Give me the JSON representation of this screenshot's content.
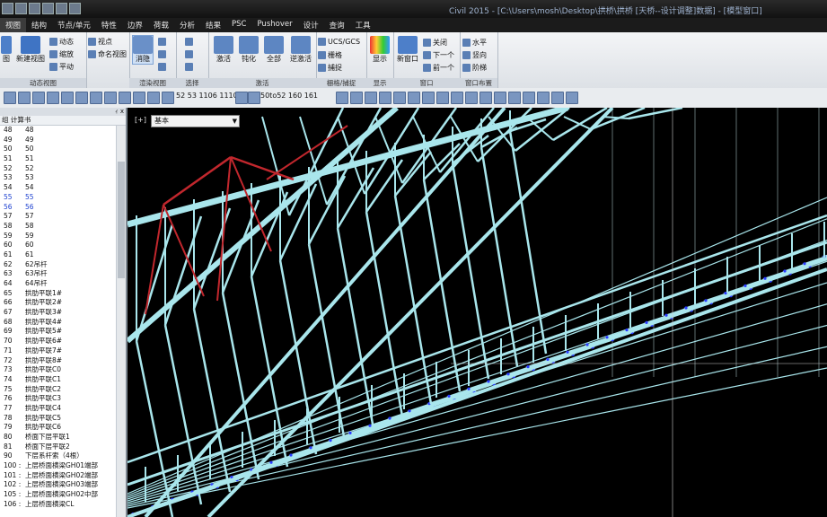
{
  "window": {
    "title": "Civil 2015 - [C:\\Users\\mosh\\Desktop\\拱桥\\拱桥 [天桥--设计调整]数据] - [模型窗口]"
  },
  "menu": [
    "视图",
    "结构",
    "节点/单元",
    "特性",
    "边界",
    "荷载",
    "分析",
    "结果",
    "PSC",
    "Pushover",
    "设计",
    "查询",
    "工具"
  ],
  "ribbon": {
    "groups": [
      {
        "label": "动态视图"
      },
      {
        "label": "渲染视图"
      },
      {
        "label": "选择"
      },
      {
        "label": "激活"
      },
      {
        "label": "栅格/捕捉"
      },
      {
        "label": "显示"
      },
      {
        "label": "窗口"
      },
      {
        "label": "窗口布置"
      }
    ],
    "buttons": {
      "view": "图",
      "new_view": "新建视图",
      "dynamic": "动态",
      "zoom": "缩放",
      "pan": "平动",
      "viewpoint": "视点",
      "named_view": "命名视图",
      "hidden": "消隐",
      "activate": "激活",
      "inactivate": "钝化",
      "all": "全部",
      "inverse": "逆激活",
      "ucs": "UCS/GCS",
      "grid": "栅格",
      "snap": "捕捉",
      "display": "显示",
      "new_window": "新窗口",
      "close": "关闭",
      "next": "下一个",
      "prev": "前一个",
      "horizontal": "水平",
      "vertical": "竖向",
      "cascade": "阶梯"
    }
  },
  "toolbar2": {
    "field1": "52 53 1106 1110",
    "field2": "50to52 160 161"
  },
  "panel": {
    "header": "组 计算书",
    "pin": "ｨ x",
    "rows": [
      {
        "id": "48",
        "name": "48"
      },
      {
        "id": "49",
        "name": "49"
      },
      {
        "id": "50",
        "name": "50"
      },
      {
        "id": "51",
        "name": "51"
      },
      {
        "id": "52",
        "name": "52"
      },
      {
        "id": "53",
        "name": "53"
      },
      {
        "id": "54",
        "name": "54"
      },
      {
        "id": "55",
        "name": "55",
        "blue": true
      },
      {
        "id": "56",
        "name": "56",
        "blue": true
      },
      {
        "id": "57",
        "name": "57"
      },
      {
        "id": "58",
        "name": "58"
      },
      {
        "id": "59",
        "name": "59"
      },
      {
        "id": "60",
        "name": "60"
      },
      {
        "id": "61",
        "name": "61"
      },
      {
        "id": "62",
        "name": "62吊杆"
      },
      {
        "id": "63",
        "name": "63吊杆"
      },
      {
        "id": "64",
        "name": "64吊杆"
      },
      {
        "id": "65",
        "name": "拱肋平联1#"
      },
      {
        "id": "66",
        "name": "拱肋平联2#"
      },
      {
        "id": "67",
        "name": "拱肋平联3#"
      },
      {
        "id": "68",
        "name": "拱肋平联4#"
      },
      {
        "id": "69",
        "name": "拱肋平联5#"
      },
      {
        "id": "70",
        "name": "拱肋平联6#"
      },
      {
        "id": "71",
        "name": "拱肋平联7#"
      },
      {
        "id": "72",
        "name": "拱肋平联8#"
      },
      {
        "id": "73",
        "name": "拱肋平联C0"
      },
      {
        "id": "74",
        "name": "拱肋平联C1"
      },
      {
        "id": "75",
        "name": "拱肋平联C2"
      },
      {
        "id": "76",
        "name": "拱肋平联C3"
      },
      {
        "id": "77",
        "name": "拱肋平联C4"
      },
      {
        "id": "78",
        "name": "拱肋平联C5"
      },
      {
        "id": "79",
        "name": "拱肋平联C6"
      },
      {
        "id": "80",
        "name": "桥面下层平联1"
      },
      {
        "id": "81",
        "name": "桥面下层平联2"
      },
      {
        "id": "90",
        "name": "下层系杆索（4根）"
      },
      {
        "id": "100 :",
        "name": "上层桥面横梁GH01端部"
      },
      {
        "id": "101 :",
        "name": "上层桥面横梁GH02端部"
      },
      {
        "id": "102 :",
        "name": "上层桥面横梁GH03端部"
      },
      {
        "id": "105 :",
        "name": "上层桥面横梁GH02中部"
      },
      {
        "id": "106 :",
        "name": "上层桥面横梁CL"
      }
    ]
  },
  "viewport": {
    "combo": "基本",
    "corner_label": "[+]"
  },
  "colors": {
    "member": "#a9e6ec",
    "highlight": "#c1272d",
    "node": "#2a3cff"
  }
}
